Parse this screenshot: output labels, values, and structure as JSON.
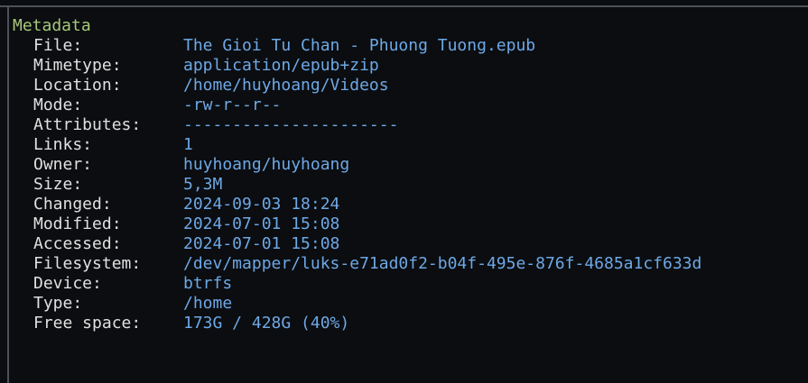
{
  "metadata": {
    "title": "Metadata",
    "rows": [
      {
        "label": "File:",
        "value": "The Gioi Tu Chan - Phuong Tuong.epub"
      },
      {
        "label": "Mimetype:",
        "value": "application/epub+zip"
      },
      {
        "label": "Location:",
        "value": "/home/huyhoang/Videos"
      },
      {
        "label": "Mode:",
        "value": "-rw-r--r--"
      },
      {
        "label": "Attributes:",
        "value": "----------------------"
      },
      {
        "label": "Links:",
        "value": "1"
      },
      {
        "label": "Owner:",
        "value": "huyhoang/huyhoang"
      },
      {
        "label": "Size:",
        "value": "5,3M"
      },
      {
        "label": "Changed:",
        "value": "2024-09-03 18:24"
      },
      {
        "label": "Modified:",
        "value": "2024-07-01 15:08"
      },
      {
        "label": "Accessed:",
        "value": "2024-07-01 15:08"
      },
      {
        "label": "Filesystem:",
        "value": "/dev/mapper/luks-e71ad0f2-b04f-495e-876f-4685a1cf633d"
      },
      {
        "label": "Device:",
        "value": "btrfs"
      },
      {
        "label": "Type:",
        "value": "/home"
      },
      {
        "label": "Free space:",
        "value": "173G / 428G (40%)"
      }
    ]
  },
  "colors": {
    "background": "#0b0d10",
    "section_title": "#a7c97a",
    "label": "#e0e0e0",
    "value": "#6ea8e6",
    "border": "#4d5258"
  }
}
